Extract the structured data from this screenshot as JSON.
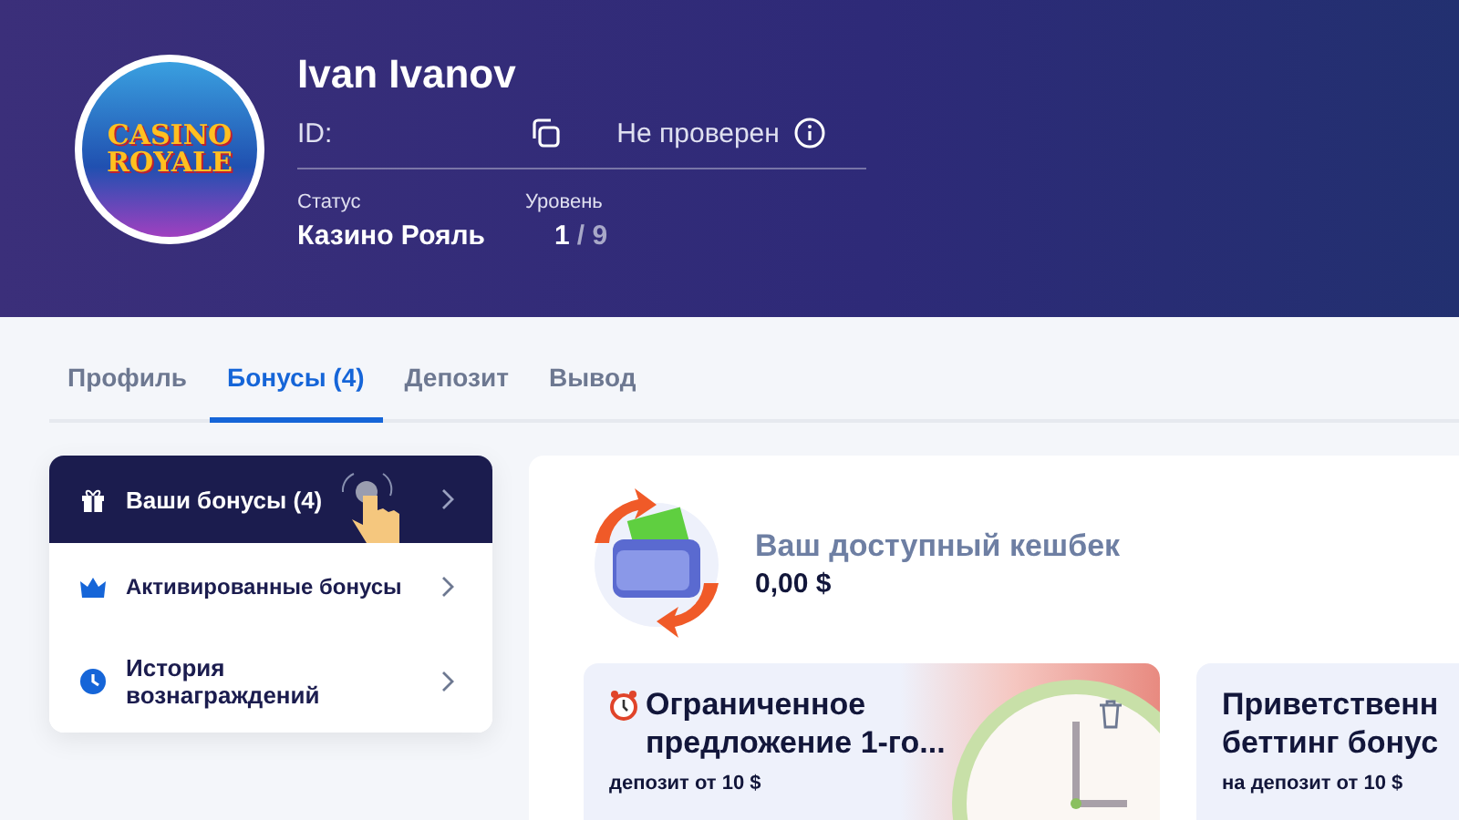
{
  "profile": {
    "name": "Ivan Ivanov",
    "id_label": "ID:",
    "verification": "Не проверен",
    "status_label": "Статус",
    "status_value": "Казино Рояль",
    "level_label": "Уровень",
    "level_current": "1",
    "level_total": "/ 9",
    "avatar_text": [
      "CASINO",
      "ROYALE"
    ]
  },
  "tabs": [
    {
      "label": "Профиль",
      "selected": false
    },
    {
      "label": "Бонусы",
      "count": "(4)",
      "selected": true
    },
    {
      "label": "Депозит",
      "selected": false
    },
    {
      "label": "Вывод",
      "selected": false
    }
  ],
  "menu": [
    {
      "label": "Ваши бонусы",
      "count": "(4)",
      "selected": true
    },
    {
      "label": "Активированные бонусы",
      "selected": false
    },
    {
      "label": "История вознаграждений",
      "selected": false
    }
  ],
  "cashback": {
    "label": "Ваш доступный кешбек",
    "value": "0,00 $"
  },
  "offers": [
    {
      "kind": "timed",
      "title_lines": [
        "Ограниченное",
        "предложение 1-го..."
      ],
      "subtitle": "депозит от 10 $"
    },
    {
      "kind": "plain",
      "title_lines": [
        "Приветственн",
        "беттинг бонус"
      ],
      "subtitle": "на депозит от 10 $"
    }
  ]
}
